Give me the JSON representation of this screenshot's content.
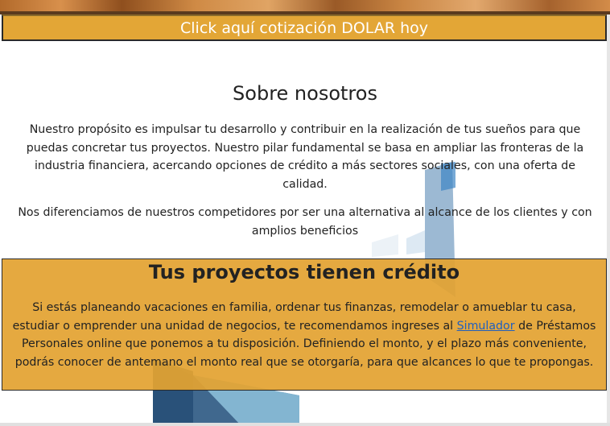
{
  "banner": {
    "dolar_link": "Click aquí cotización DOLAR hoy"
  },
  "about": {
    "title": "Sobre nosotros",
    "paragraph1": "Nuestro propósito es impulsar tu desarrollo y contribuir en la realización de tus sueños para que puedas concretar tus proyectos. Nuestro pilar fundamental se basa en ampliar las fronteras de la industria financiera, acercando opciones de crédito a más sectores sociales, con una oferta de calidad.",
    "paragraph2": "Nos diferenciamos de nuestros competidores por ser una alternativa al alcance de los clientes y con amplios beneficios"
  },
  "credit": {
    "title": "Tus proyectos tienen crédito",
    "text_before_link": "Si estás planeando vacaciones en familia, ordenar tus finanzas, remodelar o amueblar tu casa, estudiar o emprender una unidad de negocios, te recomendamos ingreses al ",
    "link_label": "Simulador",
    "text_after_link": " de Préstamos Personales online que ponemos a tu disposición. Definiendo el monto, y el plazo más conveniente, podrás conocer de antemano el monto real que se otorgaría, para que alcances lo que te propongas."
  },
  "colors": {
    "accent": "#e3a636",
    "link": "#1f5fbf",
    "text": "#222222"
  }
}
